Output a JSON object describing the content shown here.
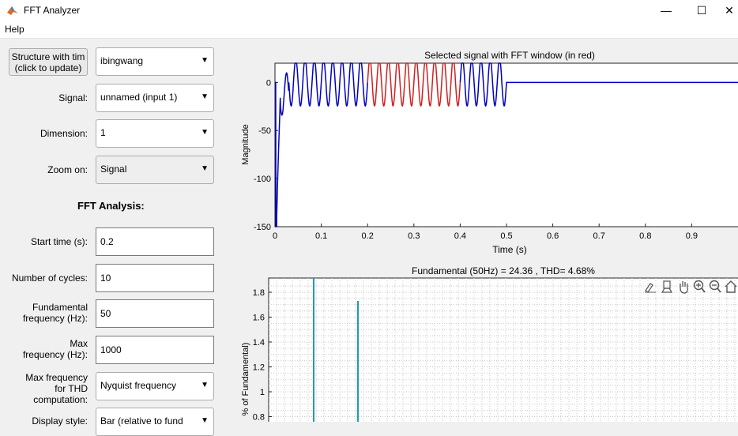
{
  "window": {
    "title": "FFT Analyzer",
    "minimize": "—",
    "maximize": "☐",
    "close": "✕"
  },
  "menu": {
    "help": "Help"
  },
  "controls": {
    "structure_button": [
      "Structure with tim",
      "(click to update)"
    ],
    "structure_value": "ibingwang",
    "signal_label": "Signal:",
    "signal_value": "unnamed (input 1)",
    "dimension_label": "Dimension:",
    "dimension_value": "1",
    "zoom_label": "Zoom on:",
    "zoom_value": "Signal",
    "fft_title": "FFT Analysis:",
    "start_time_label": "Start time (s):",
    "start_time_value": "0.2",
    "cycles_label": "Number of cycles:",
    "cycles_value": "10",
    "fund_label": [
      "Fundamental",
      "frequency (Hz):"
    ],
    "fund_value": "50",
    "maxf_label": [
      "Max",
      "frequency (Hz):"
    ],
    "maxf_value": "1000",
    "maxthd_label": [
      "Max frequency",
      "for THD",
      "computation:"
    ],
    "maxthd_value": "Nyquist frequency",
    "display_label": "Display style:",
    "display_value": "Bar (relative to fund"
  },
  "icons": {
    "arrow": "▼",
    "app": "matlab-logo-icon",
    "toolbar": [
      "brush-icon",
      "data-tips-icon",
      "pan-icon",
      "zoom-in-icon",
      "zoom-out-icon",
      "home-icon"
    ]
  },
  "colors": {
    "signal": "#0000c0",
    "fft_window": "#d02020",
    "bar": "#1f9bb4"
  },
  "chart_data": [
    {
      "type": "line",
      "title": "Selected signal with FFT window (in red)",
      "xlabel": "Time (s)",
      "ylabel": "Magnitude",
      "xlim": [
        0,
        1
      ],
      "ylim": [
        -150,
        20
      ],
      "x_ticks": [
        "0",
        "0.1",
        "0.2",
        "0.3",
        "0.4",
        "0.5",
        "0.6",
        "0.7",
        "0.8",
        "0.9"
      ],
      "y_ticks": [
        "0",
        "-50",
        "-100",
        "-150"
      ],
      "signal": {
        "frequency_hz": 50,
        "amplitude": 24.36,
        "active_until": 0.5,
        "value_after": 0
      },
      "fft_window": [
        0.2,
        0.4
      ],
      "grid": false
    },
    {
      "type": "bar",
      "title": "Fundamental (50Hz) = 24.36 , THD= 4.68%",
      "ylabel": "% of Fundamental)",
      "y_ticks": [
        "1.8",
        "1.6",
        "1.4",
        "1.2",
        "1",
        "0.8"
      ],
      "ylim_visible": [
        0.75,
        1.9
      ],
      "bars": [
        {
          "harmonic_index": 1,
          "value": 100
        },
        {
          "harmonic_index": 2,
          "value": 1.73
        }
      ],
      "grid": true
    }
  ]
}
